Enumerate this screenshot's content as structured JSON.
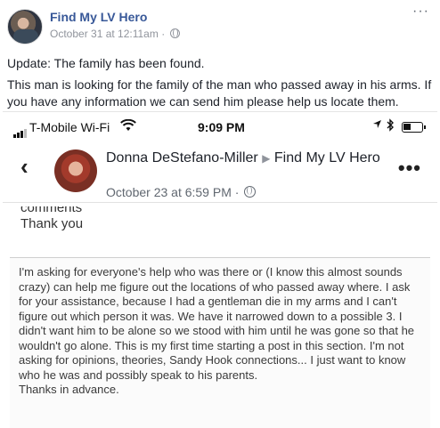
{
  "post": {
    "page_name": "Find My LV Hero",
    "timestamp": "October 31 at 12:11am",
    "separator": "·",
    "update_text": "Update: The family has been found.",
    "body_text": "This man is looking for the family of the man who passed away in his arms. If you have any information we can send him please help us locate them.",
    "more_icon": "···"
  },
  "screenshot": {
    "status_bar": {
      "carrier": "T-Mobile Wi-Fi",
      "wifi_icon": "wifi-icon",
      "time": "9:09 PM",
      "location_icon": "location-arrow-icon",
      "bluetooth_icon": "bluetooth-icon",
      "battery_icon": "battery-icon"
    },
    "header": {
      "back_icon": "‹",
      "author": "Donna DeStefano-Miller",
      "arrow": "▶",
      "target": "Find My LV Hero",
      "timestamp": "October 23 at 6:59 PM",
      "separator": "·",
      "more_icon": "•••"
    },
    "previous_text": {
      "cut_line": "comments",
      "thanks": "Thank you"
    },
    "quote": "I'm asking for everyone's help who was there or (I know this almost sounds crazy) can help me figure out the locations of who passed away where. I ask for your assistance, because I had a gentleman die in my arms and I can't figure out which person it was. We have it narrowed down to a possible 3. I didn't want him to be alone so we stood with him until he was gone so that he wouldn't go alone. This is my first time starting a post in this section. I'm not asking for opinions, theories, Sandy Hook connections... I just want to know who he was and possibly speak to his parents.",
    "quote_closing": "Thanks in advance."
  }
}
